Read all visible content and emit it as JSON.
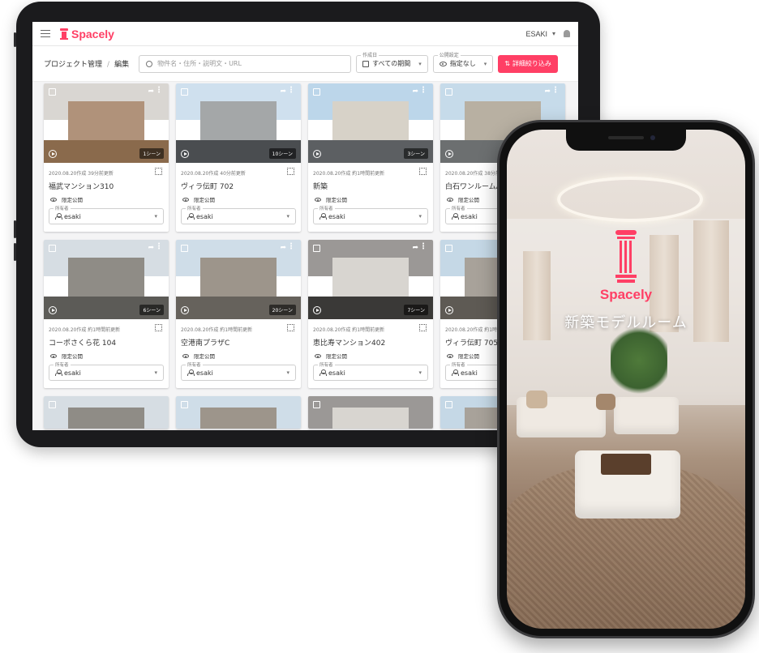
{
  "app": {
    "brand": "Spacely",
    "user": "ESAKI"
  },
  "toolbar": {
    "breadcrumb": [
      "プロジェクト管理",
      "編集"
    ],
    "search_placeholder": "物件名・住所・説明文・URL",
    "created_caption": "作成日",
    "created_value": "すべての期間",
    "visibility_caption": "公開設定",
    "visibility_value": "指定なし",
    "detail_button": "詳細絞り込み"
  },
  "card_labels": {
    "owner_caption": "所有者"
  },
  "cards": [
    {
      "date": "2020.08.20作成 39分前更新",
      "title": "福武マンション310",
      "visibility": "限定公開",
      "owner": "esaki",
      "scenes": "1シーン"
    },
    {
      "date": "2020.08.20作成 40分前更新",
      "title": "ヴィラ伝町 702",
      "visibility": "限定公開",
      "owner": "esaki",
      "scenes": "10シーン"
    },
    {
      "date": "2020.08.20作成 約1時間前更新",
      "title": "新築",
      "visibility": "限定公開",
      "owner": "esaki",
      "scenes": "3シーン"
    },
    {
      "date": "2020.08.20作成 38分前",
      "title": "白石ワンルームA",
      "visibility": "限定公開",
      "owner": "esaki",
      "scenes": ""
    },
    {
      "date": "2020.08.20作成 約1時間前更新",
      "title": "コーポさくら花 104",
      "visibility": "限定公開",
      "owner": "esaki",
      "scenes": "6シーン"
    },
    {
      "date": "2020.08.20作成 約1時間前更新",
      "title": "空港南プラザC",
      "visibility": "限定公開",
      "owner": "esaki",
      "scenes": "20シーン"
    },
    {
      "date": "2020.08.20作成 約1時間前更新",
      "title": "恵比寿マンション402",
      "visibility": "限定公開",
      "owner": "esaki",
      "scenes": "7シーン"
    },
    {
      "date": "2020.08.20作成 約1時間前",
      "title": "ヴィラ伝町 705",
      "visibility": "限定公開",
      "owner": "esaki",
      "scenes": ""
    }
  ],
  "phone": {
    "brand": "Spacely",
    "title": "新築モデルルーム"
  },
  "colors": {
    "accent": "#ff3f65",
    "tablet_frame": "#1b1b1d",
    "screen_bg": "#f4f4f5"
  },
  "icons": [
    "menu-icon",
    "brand-column-icon",
    "chevron-down-icon",
    "bell-icon",
    "search-icon",
    "calendar-icon",
    "eye-icon",
    "filter-icon",
    "checkbox-icon",
    "share-icon",
    "more-vert-icon",
    "play-icon",
    "qr-code-icon",
    "user-icon"
  ]
}
